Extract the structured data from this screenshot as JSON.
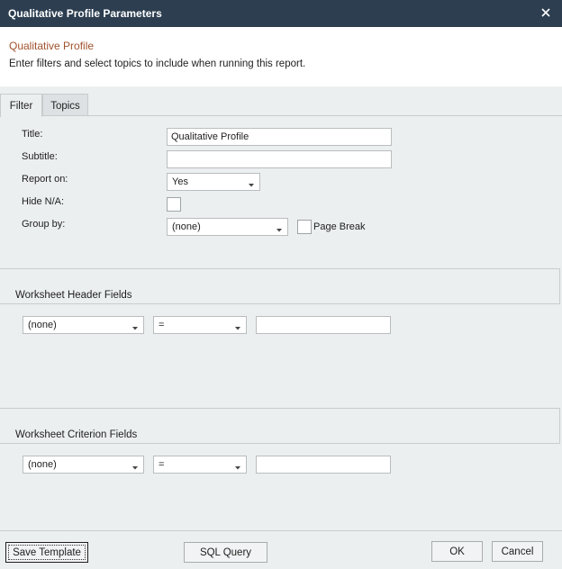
{
  "window": {
    "title": "Qualitative Profile Parameters"
  },
  "header": {
    "title": "Qualitative Profile",
    "description": "Enter filters and select topics to include when running this report."
  },
  "tabs": [
    {
      "label": "Filter",
      "active": true
    },
    {
      "label": "Topics",
      "active": false
    }
  ],
  "filter": {
    "title_label": "Title:",
    "title_value": "Qualitative Profile",
    "subtitle_label": "Subtitle:",
    "subtitle_value": "",
    "report_on_label": "Report on:",
    "report_on_value": "Yes",
    "hide_na_label": "Hide N/A:",
    "group_by_label": "Group by:",
    "group_by_value": "(none)",
    "page_break_label": "Page Break"
  },
  "header_fields": {
    "title": "Worksheet Header Fields",
    "field_value": "(none)",
    "operator_value": "=",
    "input_value": ""
  },
  "criterion_fields": {
    "title": "Worksheet Criterion Fields",
    "field_value": "(none)",
    "operator_value": "=",
    "input_value": ""
  },
  "footer": {
    "save_template": "Save Template",
    "sql_query": "SQL Query",
    "ok": "OK",
    "cancel": "Cancel"
  },
  "colors": {
    "titlebar": "#2c3e50",
    "accent_title": "#a0522d",
    "background": "#eceff0"
  }
}
